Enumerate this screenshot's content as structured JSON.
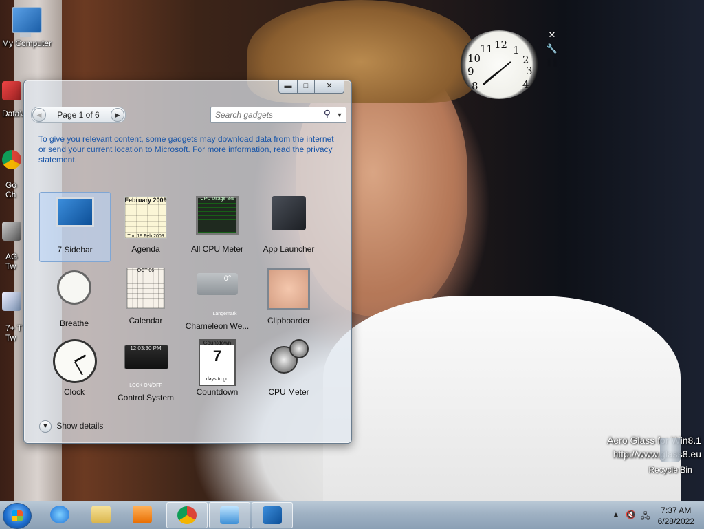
{
  "desktop": {
    "icons": [
      {
        "label": "My Computer"
      },
      {
        "label": "DataV"
      },
      {
        "label": "Go\nCh"
      },
      {
        "label": "AG\nTw"
      },
      {
        "label": "7+ T\nTw"
      }
    ],
    "watermark": {
      "line1": "Aero Glass for Win8.1",
      "line2": "http://www.glass8.eu"
    },
    "recycle_bin": "Recycle Bin",
    "clock_gadget": {
      "numbers": [
        "12",
        "1",
        "2",
        "3",
        "4",
        "8",
        "9",
        "10",
        "11"
      ]
    },
    "gadget_controls": [
      "✕",
      "🔧",
      "⋮⋮"
    ]
  },
  "gallery": {
    "window_buttons": {
      "minimize": "▬",
      "maximize": "□",
      "close": "✕"
    },
    "pager": {
      "label": "Page 1 of 6",
      "prev": "◀",
      "next": "▶"
    },
    "search": {
      "placeholder": "Search gadgets",
      "icon": "search-icon"
    },
    "notice": "To give you relevant content, some gadgets may download data from the internet or send your current location to Microsoft. For more information, read the privacy statement.",
    "gadgets": [
      {
        "name": "7 Sidebar",
        "selected": true
      },
      {
        "name": "Agenda"
      },
      {
        "name": "All CPU Meter"
      },
      {
        "name": "App Launcher"
      },
      {
        "name": "Breathe"
      },
      {
        "name": "Calendar"
      },
      {
        "name": "Chameleon We..."
      },
      {
        "name": "Clipboarder"
      },
      {
        "name": "Clock"
      },
      {
        "name": "Control System"
      },
      {
        "name": "Countdown"
      },
      {
        "name": "CPU Meter"
      }
    ],
    "thumb_text": {
      "agenda_month": "February 2009",
      "agenda_foot": "Thu 19 Feb 2009",
      "cpu_title": "CPU Usage 8%",
      "cal_month": "OCT 06",
      "cham_temp": "0°",
      "cham_city": "Langemark",
      "control_time": "12:03:30 PM",
      "control_label": "LOCK ON/OFF",
      "countdown_title": "Countdown",
      "countdown_num": "7",
      "countdown_foot": "days to go"
    },
    "show_details": "Show details"
  },
  "taskbar": {
    "clock": {
      "time": "7:37 AM",
      "date": "6/28/2022"
    },
    "tray_icons": [
      "show-hidden-icon",
      "volume-muted-icon",
      "network-icon"
    ]
  }
}
